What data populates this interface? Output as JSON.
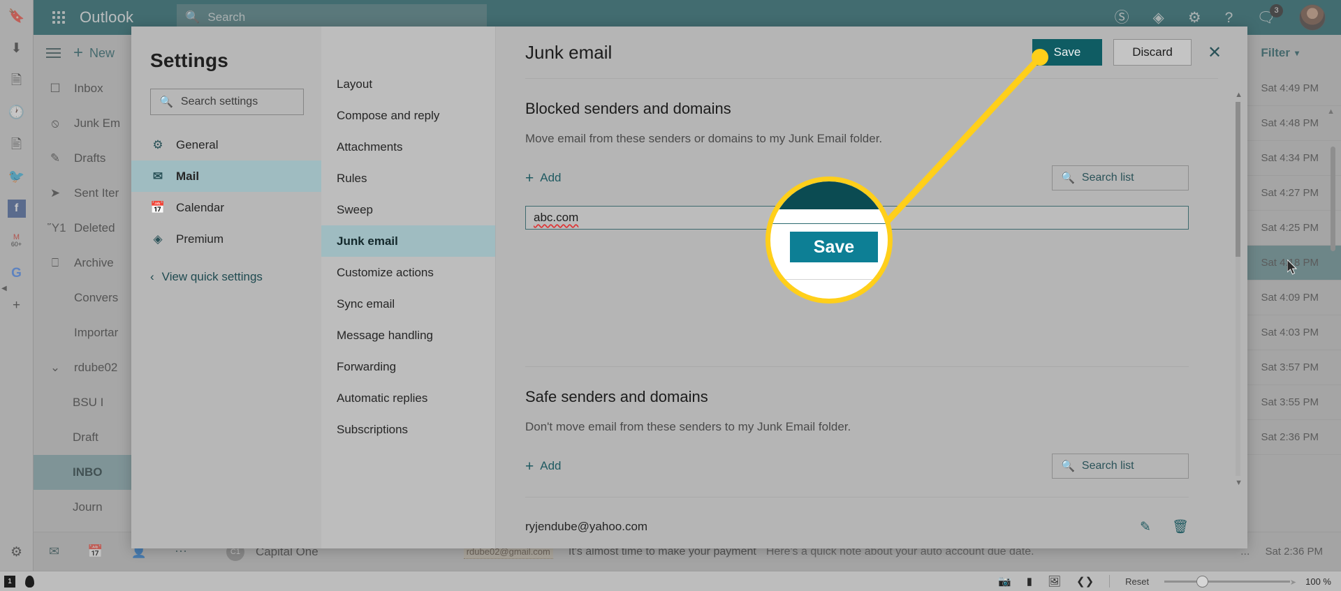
{
  "browser_rail": {
    "icons": [
      "bookmark-icon",
      "download-icon",
      "reading-list-icon",
      "history-icon",
      "window-icon",
      "twitter-icon",
      "facebook-icon",
      "gmail-icon",
      "google-icon",
      "add-icon"
    ],
    "gmail_badge": "60+",
    "bottom_icon": "gear-icon"
  },
  "outlook_header": {
    "brand": "Outlook",
    "search_placeholder": "Search",
    "right_icons": [
      "skype-icon",
      "premium-diamond-icon",
      "gear-icon",
      "help-icon",
      "feedback-icon"
    ],
    "notification_count": "3"
  },
  "folder_pane": {
    "new_label": "New",
    "items": [
      {
        "label": "Inbox",
        "icon": "inbox-icon",
        "indent": false,
        "selected": false
      },
      {
        "label": "Junk Em",
        "icon": "block-icon",
        "indent": false,
        "selected": false
      },
      {
        "label": "Drafts",
        "icon": "pencil-icon",
        "indent": false,
        "selected": false
      },
      {
        "label": "Sent Iter",
        "icon": "send-icon",
        "indent": false,
        "selected": false
      },
      {
        "label": "Deleted",
        "icon": "trash-icon",
        "indent": false,
        "selected": false
      },
      {
        "label": "Archive",
        "icon": "archive-icon",
        "indent": false,
        "selected": false
      },
      {
        "label": "Convers",
        "icon": "",
        "indent": false,
        "selected": false
      },
      {
        "label": "Importar",
        "icon": "",
        "indent": false,
        "selected": false
      },
      {
        "label": "rdube02",
        "icon": "chevron-down-icon",
        "indent": false,
        "selected": false
      },
      {
        "label": "BSU I",
        "icon": "",
        "indent": true,
        "selected": false
      },
      {
        "label": "Draft",
        "icon": "",
        "indent": true,
        "selected": false
      },
      {
        "label": "INBO",
        "icon": "",
        "indent": true,
        "selected": true
      },
      {
        "label": "Journ",
        "icon": "",
        "indent": true,
        "selected": false
      }
    ],
    "bottom_icons": [
      "mail-icon",
      "calendar-icon"
    ]
  },
  "message_pane": {
    "filter_label": "Filter",
    "rows": [
      {
        "time": "Sat 4:49 PM",
        "selected": false
      },
      {
        "time": "Sat 4:48 PM",
        "selected": false
      },
      {
        "time": "Sat 4:34 PM",
        "selected": false
      },
      {
        "time": "Sat 4:27 PM",
        "selected": false
      },
      {
        "time": "Sat 4:25 PM",
        "selected": false
      },
      {
        "time": "Sat 4:18 PM",
        "selected": true
      },
      {
        "time": "Sat 4:09 PM",
        "selected": false
      },
      {
        "time": "Sat 4:03 PM",
        "selected": false
      },
      {
        "time": "Sat 3:57 PM",
        "selected": false
      },
      {
        "time": "Sat 3:55 PM",
        "selected": false
      },
      {
        "time": "Sat 2:36 PM",
        "selected": false
      }
    ]
  },
  "bottom_message": {
    "avatar_initials": "C1",
    "sender": "Capital One",
    "address": "rdube02@gmail.com",
    "subject": "It's almost time to make your payment",
    "snippet": "Here's a quick note about your auto account due date.",
    "overflow": "...",
    "time": "Sat 2:36 PM",
    "left_icons": [
      "mail-icon",
      "calendar-icon",
      "people-icon",
      "more-icon"
    ]
  },
  "statusbar": {
    "left_icons": [
      "page-icon",
      "drop-icon"
    ],
    "right_icons": [
      "camera-icon",
      "frame-icon",
      "image-icon",
      "code-icon"
    ],
    "reset_label": "Reset",
    "zoom_percent": "100 %"
  },
  "settings": {
    "title": "Settings",
    "search_placeholder": "Search settings",
    "nav": [
      {
        "label": "General",
        "icon": "gear-icon",
        "selected": false
      },
      {
        "label": "Mail",
        "icon": "mail-icon",
        "selected": true
      },
      {
        "label": "Calendar",
        "icon": "calendar-icon",
        "selected": false
      },
      {
        "label": "Premium",
        "icon": "diamond-icon",
        "selected": false
      }
    ],
    "quick_settings_label": "View quick settings",
    "mid_items": [
      {
        "label": "Layout",
        "selected": false
      },
      {
        "label": "Compose and reply",
        "selected": false
      },
      {
        "label": "Attachments",
        "selected": false
      },
      {
        "label": "Rules",
        "selected": false
      },
      {
        "label": "Sweep",
        "selected": false
      },
      {
        "label": "Junk email",
        "selected": true
      },
      {
        "label": "Customize actions",
        "selected": false
      },
      {
        "label": "Sync email",
        "selected": false
      },
      {
        "label": "Message handling",
        "selected": false
      },
      {
        "label": "Forwarding",
        "selected": false
      },
      {
        "label": "Automatic replies",
        "selected": false
      },
      {
        "label": "Subscriptions",
        "selected": false
      }
    ],
    "panel_title": "Junk email",
    "save_label": "Save",
    "discard_label": "Discard",
    "close_icon": "close-icon",
    "blocked": {
      "heading": "Blocked senders and domains",
      "description": "Move email from these senders or domains to my Junk Email folder.",
      "add_label": "Add",
      "search_placeholder": "Search list",
      "input_value": "abc.com"
    },
    "safe": {
      "heading": "Safe senders and domains",
      "description": "Don't move email from these senders to my Junk Email folder.",
      "add_label": "Add",
      "search_placeholder": "Search list",
      "entries": [
        {
          "address": "ryjendube@yahoo.com",
          "edit_icon": "pencil-icon",
          "delete_icon": "trash-icon"
        }
      ]
    }
  },
  "callout": {
    "magnified_label": "Save",
    "accent_color": "#ffcf1a",
    "button_color": "#0d7f95"
  }
}
